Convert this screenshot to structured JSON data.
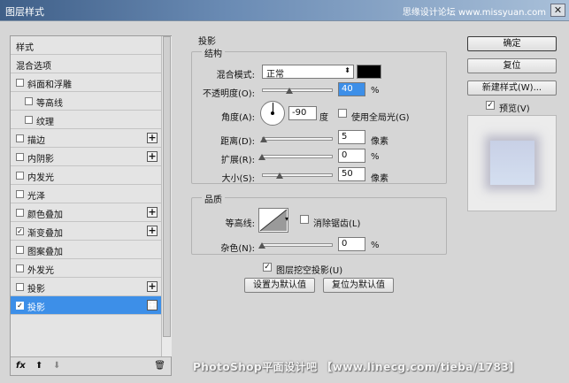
{
  "window": {
    "title": "图层样式",
    "close_glyph": "✕",
    "watermark_top": "思缘设计论坛 www.missyuan.com"
  },
  "left_panel": {
    "items": [
      {
        "label": "样式",
        "checkbox": false,
        "checked": false,
        "plus": false
      },
      {
        "label": "混合选项",
        "checkbox": false,
        "checked": false,
        "plus": false
      },
      {
        "label": "斜面和浮雕",
        "checkbox": true,
        "checked": false,
        "plus": false
      },
      {
        "label": "等高线",
        "checkbox": true,
        "checked": false,
        "plus": false,
        "indent": true
      },
      {
        "label": "纹理",
        "checkbox": true,
        "checked": false,
        "plus": false,
        "indent": true
      },
      {
        "label": "描边",
        "checkbox": true,
        "checked": false,
        "plus": true
      },
      {
        "label": "内阴影",
        "checkbox": true,
        "checked": false,
        "plus": true
      },
      {
        "label": "内发光",
        "checkbox": true,
        "checked": false,
        "plus": false
      },
      {
        "label": "光泽",
        "checkbox": true,
        "checked": false,
        "plus": false
      },
      {
        "label": "颜色叠加",
        "checkbox": true,
        "checked": false,
        "plus": true
      },
      {
        "label": "渐变叠加",
        "checkbox": true,
        "checked": true,
        "plus": true
      },
      {
        "label": "图案叠加",
        "checkbox": true,
        "checked": false,
        "plus": false
      },
      {
        "label": "外发光",
        "checkbox": true,
        "checked": false,
        "plus": false
      },
      {
        "label": "投影",
        "checkbox": true,
        "checked": false,
        "plus": true
      },
      {
        "label": "投影",
        "checkbox": true,
        "checked": true,
        "plus": true,
        "selected": true
      }
    ],
    "toolbar": {
      "fx": "fx",
      "up": "⬆",
      "down": "⬇",
      "trash": "🗑"
    },
    "check_glyph": "✓",
    "plus_glyph": "+"
  },
  "drop_shadow": {
    "section_title": "投影",
    "structure": {
      "title": "结构",
      "blend_mode_label": "混合模式:",
      "blend_mode_value": "正常",
      "blend_color": "#000000",
      "opacity_label": "不透明度(O):",
      "opacity_value": "40",
      "opacity_unit": "%",
      "angle_label": "角度(A):",
      "angle_value": "-90",
      "angle_unit": "度",
      "global_light_label": "使用全局光(G)",
      "global_light_checked": false,
      "distance_label": "距离(D):",
      "distance_value": "5",
      "distance_unit": "像素",
      "spread_label": "扩展(R):",
      "spread_value": "0",
      "spread_unit": "%",
      "size_label": "大小(S):",
      "size_value": "50",
      "size_unit": "像素"
    },
    "quality": {
      "title": "品质",
      "contour_label": "等高线:",
      "antialias_label": "消除锯齿(L)",
      "antialias_checked": false,
      "noise_label": "杂色(N):",
      "noise_value": "0",
      "noise_unit": "%"
    },
    "knockout_label": "图层挖空投影(U)",
    "knockout_checked": true,
    "set_default_label": "设置为默认值",
    "reset_default_label": "复位为默认值"
  },
  "right_panel": {
    "ok_label": "确定",
    "reset_label": "复位",
    "new_style_label": "新建样式(W)...",
    "preview_label": "预览(V)",
    "preview_checked": true
  },
  "footer_watermark": "PhotoShop平面设计吧 【www.linecg.com/tieba/1783】"
}
